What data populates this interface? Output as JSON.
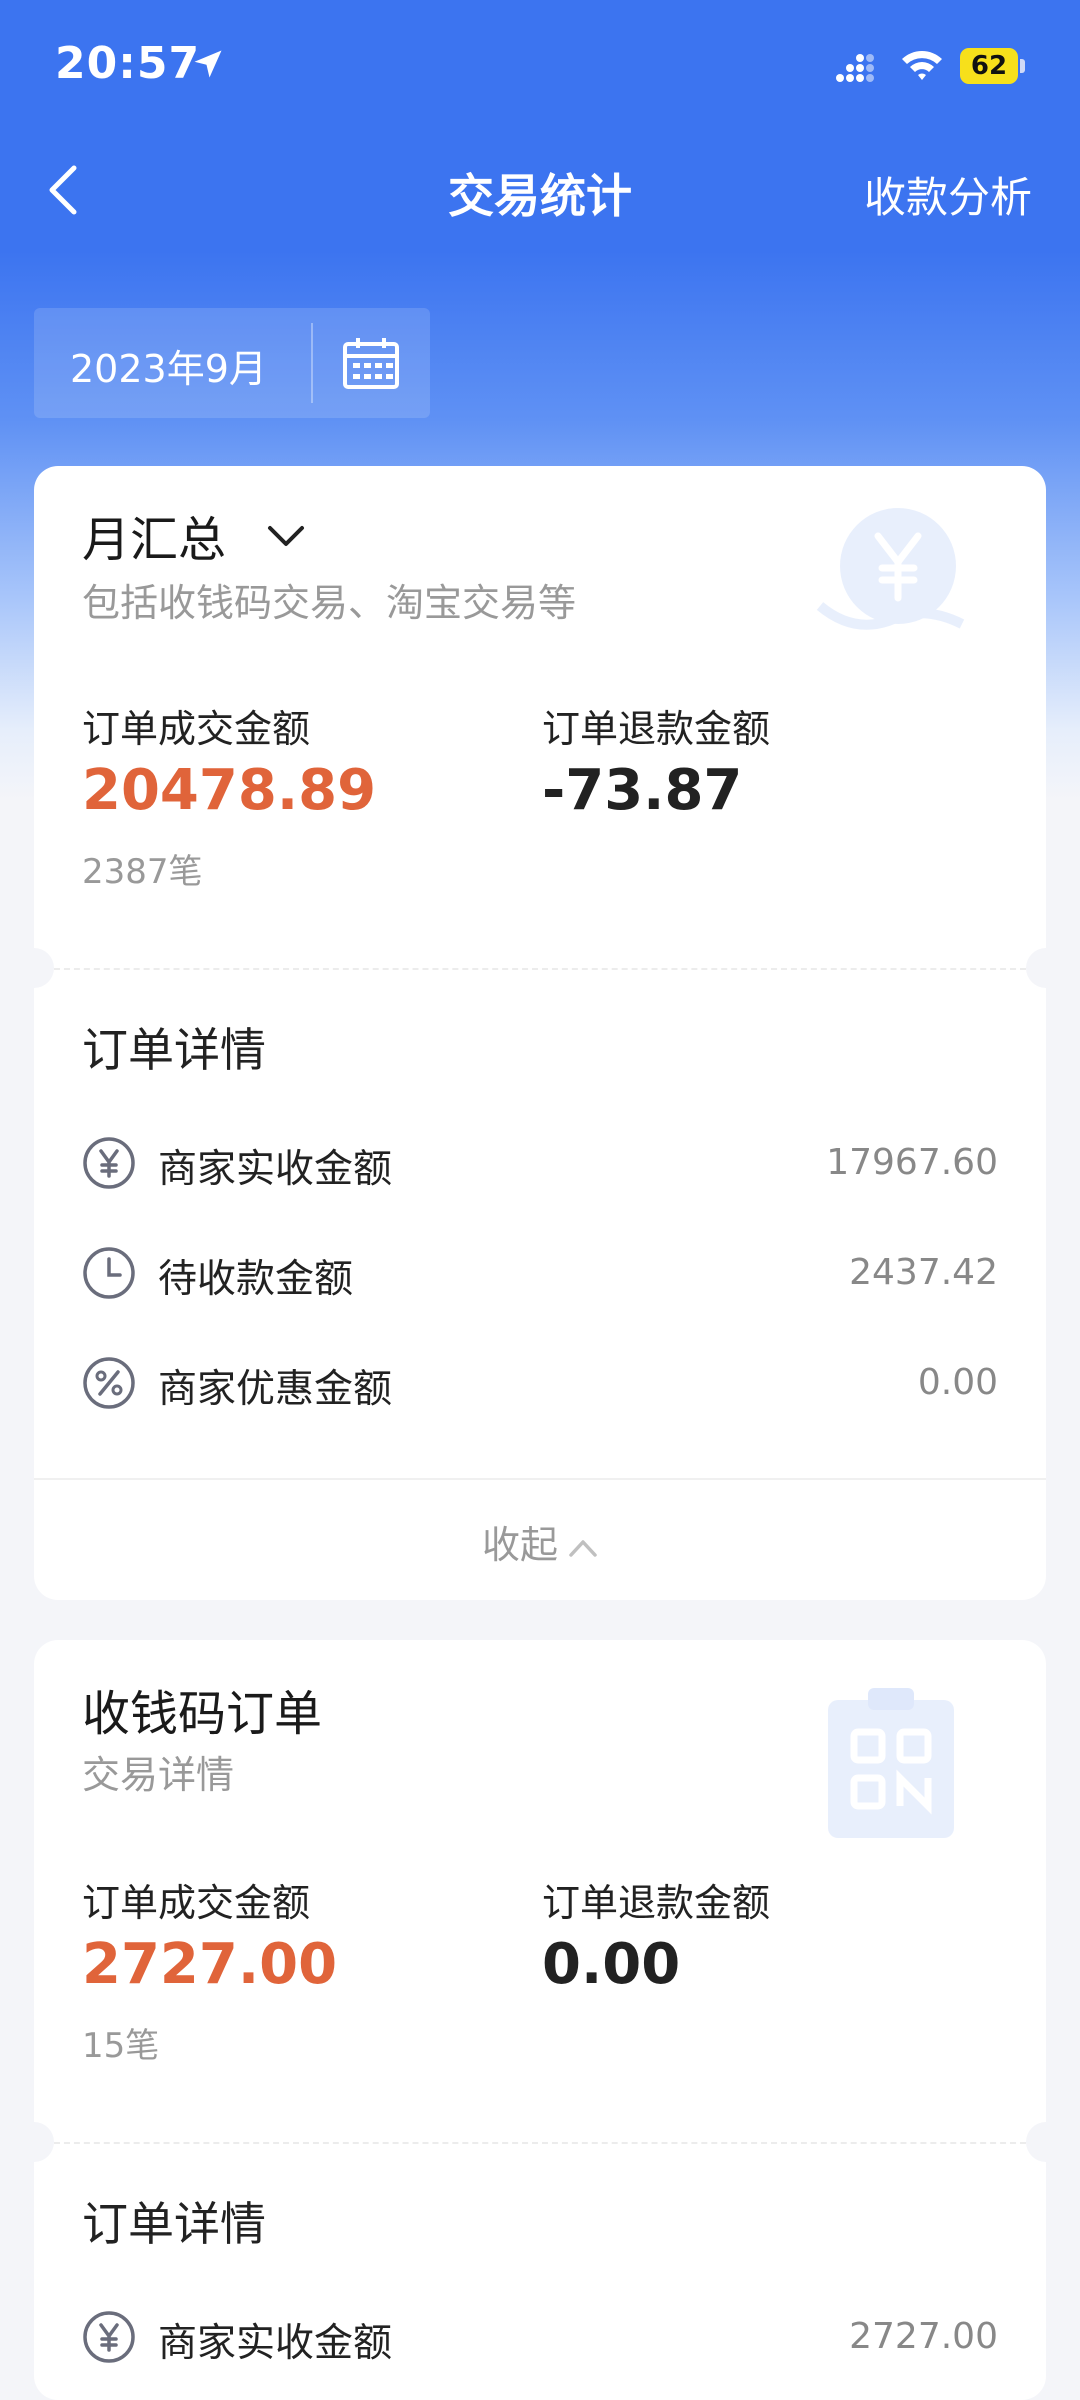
{
  "status_bar": {
    "time": "20:57",
    "battery": "62"
  },
  "nav": {
    "title": "交易统计",
    "right_action": "收款分析"
  },
  "date_filter": {
    "value": "2023年9月"
  },
  "monthly_card": {
    "title": "月汇总",
    "subtitle": "包括收钱码交易、淘宝交易等",
    "order_amount_label": "订单成交金额",
    "order_amount": "20478.89",
    "order_count": "2387笔",
    "refund_label": "订单退款金额",
    "refund_amount": "-73.87",
    "detail_title": "订单详情",
    "details": [
      {
        "icon": "yen-circle-icon",
        "label": "商家实收金额",
        "value": "17967.60"
      },
      {
        "icon": "clock-icon",
        "label": "待收款金额",
        "value": "2437.42"
      },
      {
        "icon": "percent-icon",
        "label": "商家优惠金额",
        "value": "0.00"
      }
    ],
    "collapse_label": "收起"
  },
  "qr_card": {
    "title": "收钱码订单",
    "subtitle": "交易详情",
    "order_amount_label": "订单成交金额",
    "order_amount": "2727.00",
    "order_count": "15笔",
    "refund_label": "订单退款金额",
    "refund_amount": "0.00",
    "detail_title": "订单详情",
    "details": [
      {
        "icon": "yen-circle-icon",
        "label": "商家实收金额",
        "value": "2727.00"
      }
    ]
  },
  "colors": {
    "primary": "#3c74f0",
    "amount_orange": "#e0643a",
    "page_bg": "#f4f5f9"
  }
}
